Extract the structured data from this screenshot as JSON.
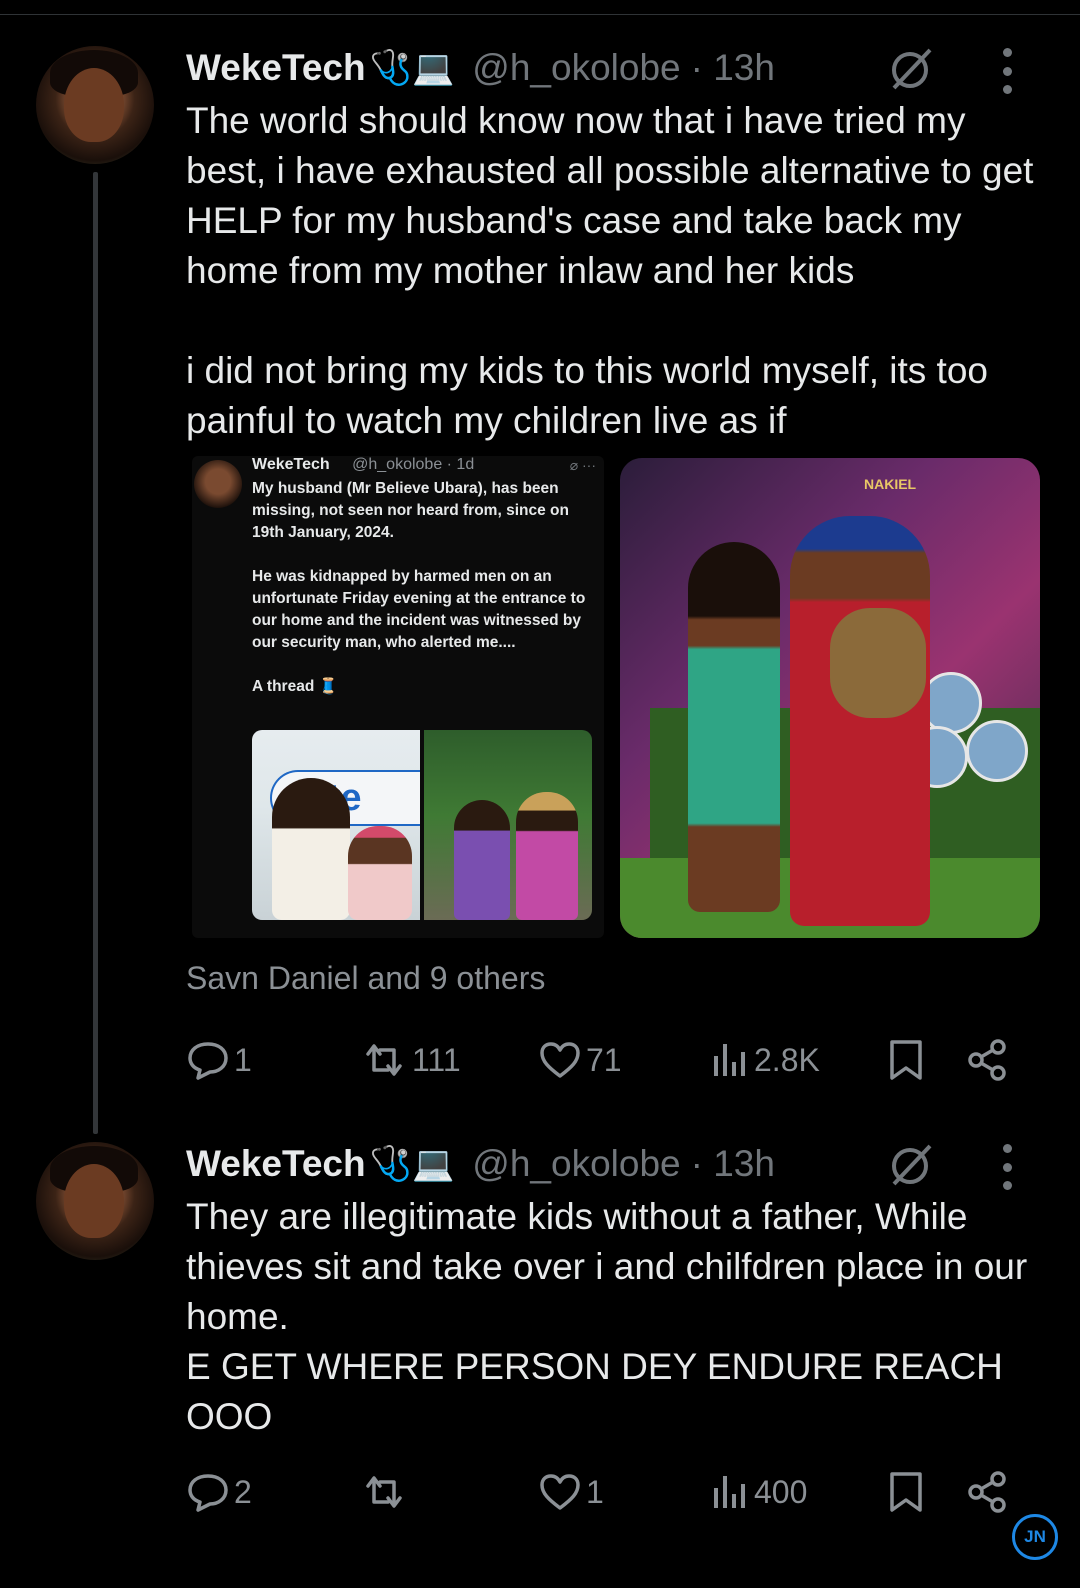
{
  "tweet1": {
    "display_name": "WekeTech",
    "badges": "🩺💻",
    "handle": "@h_okolobe",
    "time": "· 13h",
    "text": "The world should know now that i have tried my best, i have exhausted all possible alternative to get HELP for my husband's case and take back my home from my mother inlaw and her kids\n\ni did not bring my kids to this world myself, its too painful to watch my children live as if",
    "quoted": {
      "display_name": "WekeTech",
      "handle": "@h_okolobe · 1d",
      "text": "My husband (Mr Believe Ubara), has been missing, not seen nor heard from, since on 19th January, 2024.\n\nHe was kidnapped by harmed men on an unfortunate Friday evening at the entrance to our home and the incident was witnessed by our security man, who alerted me....\n\nA thread 🧵",
      "image_sign_text": "inte"
    },
    "photo_logo_text": "NAKIEL",
    "social_context": "Savn Daniel and 9 others",
    "actions": {
      "replies": "1",
      "reposts": "111",
      "likes": "71",
      "views": "2.8K"
    }
  },
  "tweet2": {
    "display_name": "WekeTech",
    "badges": "🩺💻",
    "handle": "@h_okolobe",
    "time": "· 13h",
    "text": "They are illegitimate kids without a father, While thieves sit and take over i and chilfdren place in our home.\nE GET WHERE PERSON DEY ENDURE REACH OOO",
    "actions": {
      "replies": "2",
      "reposts": "",
      "likes": "1",
      "views": "400"
    }
  },
  "watermark": "JN",
  "colors": {
    "background": "#000000",
    "text": "#e7e9ea",
    "muted": "#71767b",
    "thread_line": "#333639"
  },
  "icons": [
    "grok-icon",
    "more-icon",
    "reply-icon",
    "repost-icon",
    "like-icon",
    "views-icon",
    "bookmark-icon",
    "share-icon"
  ]
}
